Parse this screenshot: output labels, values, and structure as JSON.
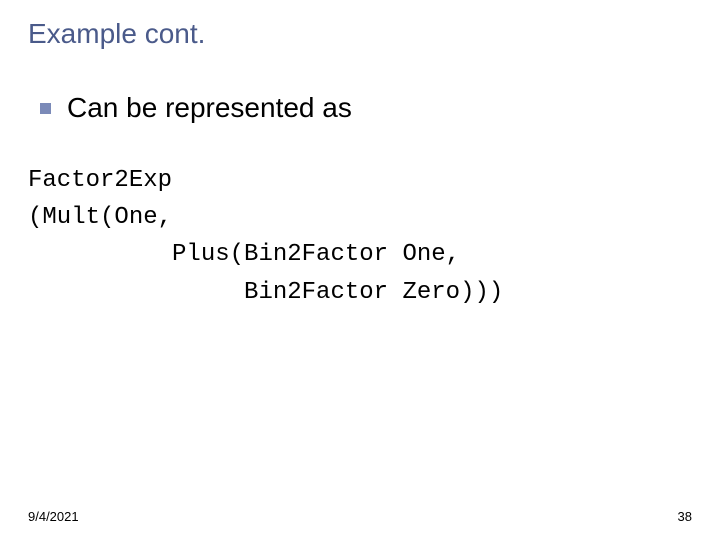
{
  "slide": {
    "title": "Example cont.",
    "bullet": "Can be represented as",
    "code": {
      "line1": "Factor2Exp",
      "line2": "(Mult(One,",
      "line3": "          Plus(Bin2Factor One,",
      "line4": "               Bin2Factor Zero)))"
    },
    "footer": {
      "date": "9/4/2021",
      "page": "38"
    }
  }
}
